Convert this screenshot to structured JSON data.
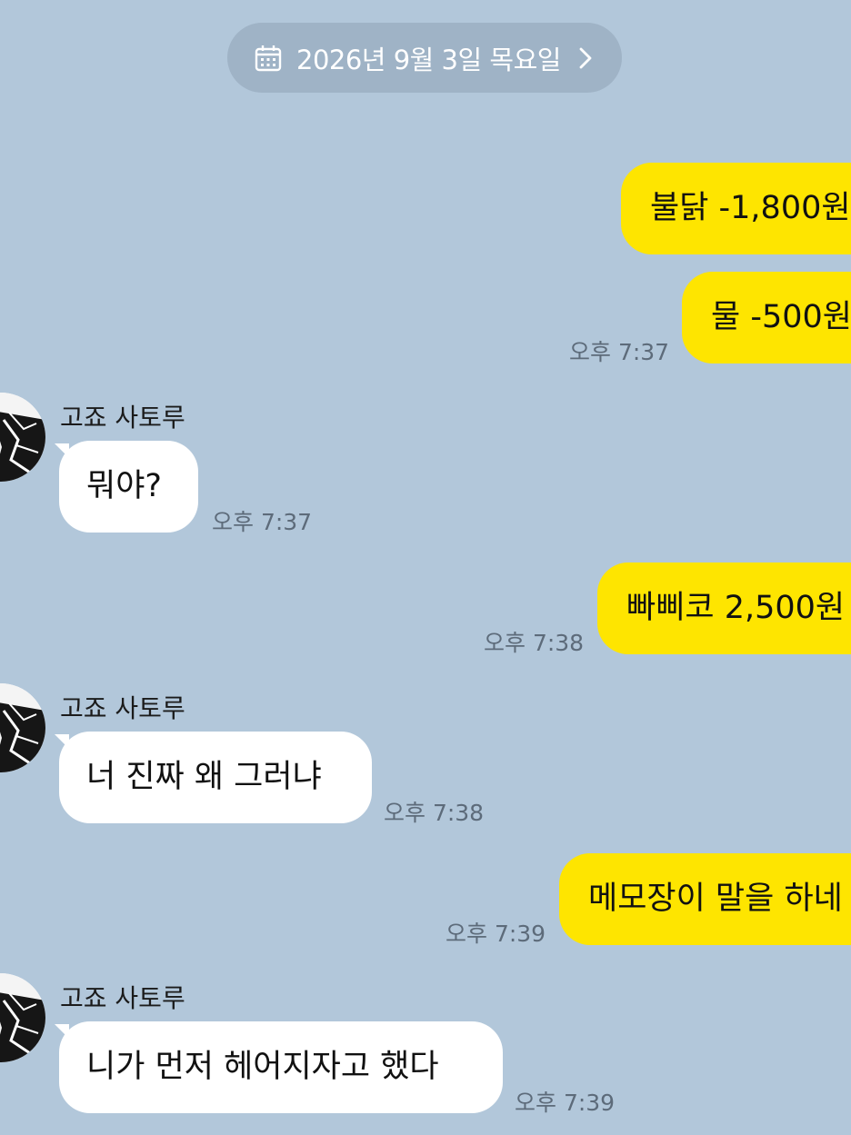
{
  "date_header": {
    "label": "2026년 9월 3일 목요일",
    "icon": "calendar-icon",
    "chevron": "chevron-right-icon"
  },
  "contact": {
    "name": "고죠 사토루"
  },
  "messages": [
    {
      "side": "me",
      "text": "불닭 -1,800원",
      "time": ""
    },
    {
      "side": "me",
      "text": "물 -500원",
      "time": "오후 7:37"
    },
    {
      "side": "them",
      "sender": "고죠 사토루",
      "text": "뭐야?",
      "time": "오후 7:37"
    },
    {
      "side": "me",
      "text": "빠삐코 2,500원",
      "time": "오후 7:38"
    },
    {
      "side": "them",
      "sender": "고죠 사토루",
      "text": "너 진짜 왜 그러냐",
      "time": "오후 7:38"
    },
    {
      "side": "me",
      "text": "메모장이 말을 하네",
      "time": "오후 7:39"
    },
    {
      "side": "them",
      "sender": "고죠 사토루",
      "text": "니가 먼저 헤어지자고 했다",
      "time": "오후 7:39"
    }
  ],
  "colors": {
    "background": "#b2c7da",
    "my_bubble": "#fee500",
    "their_bubble": "#ffffff",
    "date_pill": "#9fb3c6"
  }
}
